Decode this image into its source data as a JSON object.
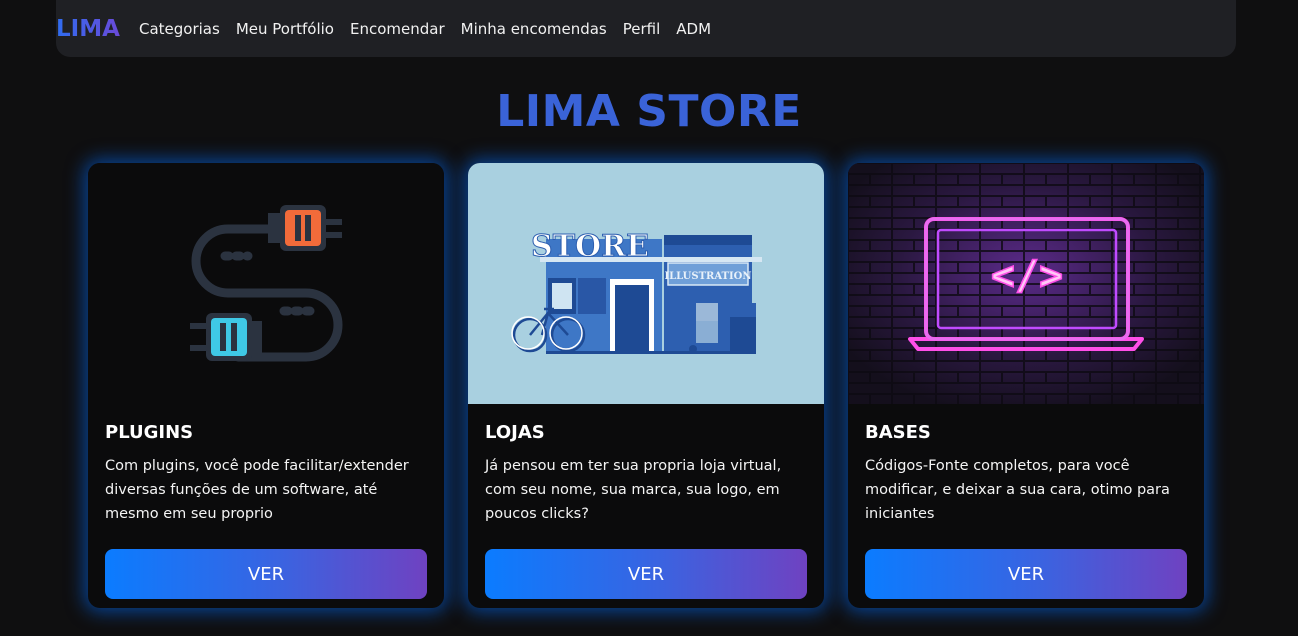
{
  "navbar": {
    "brand": "LIMA",
    "links": [
      "Categorias",
      "Meu Portfólio",
      "Encomendar",
      "Minha encomendas",
      "Perfil",
      "ADM"
    ]
  },
  "hero": {
    "title": "LIMA STORE"
  },
  "cards": [
    {
      "title": "PLUGINS",
      "description": "Com plugins, você pode facilitar/extender diversas funções de um software, até mesmo em seu proprio",
      "button": "VER",
      "image_icon": "plug-connector-icon"
    },
    {
      "title": "LOJAS",
      "description": "Já pensou em ter sua propria loja virtual, com seu nome, sua marca, sua logo, em poucos clicks?",
      "button": "VER",
      "image_icon": "storefront-illustration",
      "image_text": {
        "sign": "STORE",
        "banner": "ILLUSTRATION"
      }
    },
    {
      "title": "BASES",
      "description": "Códigos-Fonte completos, para você modificar, e deixar a sua cara, otimo para iniciantes",
      "button": "VER",
      "image_icon": "neon-laptop-code-icon",
      "image_text": {
        "code": "</>"
      }
    }
  ],
  "colors": {
    "background": "#0f0f10",
    "navbar": "#1f2024",
    "title": "#3a63d8",
    "button_start": "#0b7cff",
    "button_end": "#6f42c1",
    "glow": "#006eff"
  }
}
